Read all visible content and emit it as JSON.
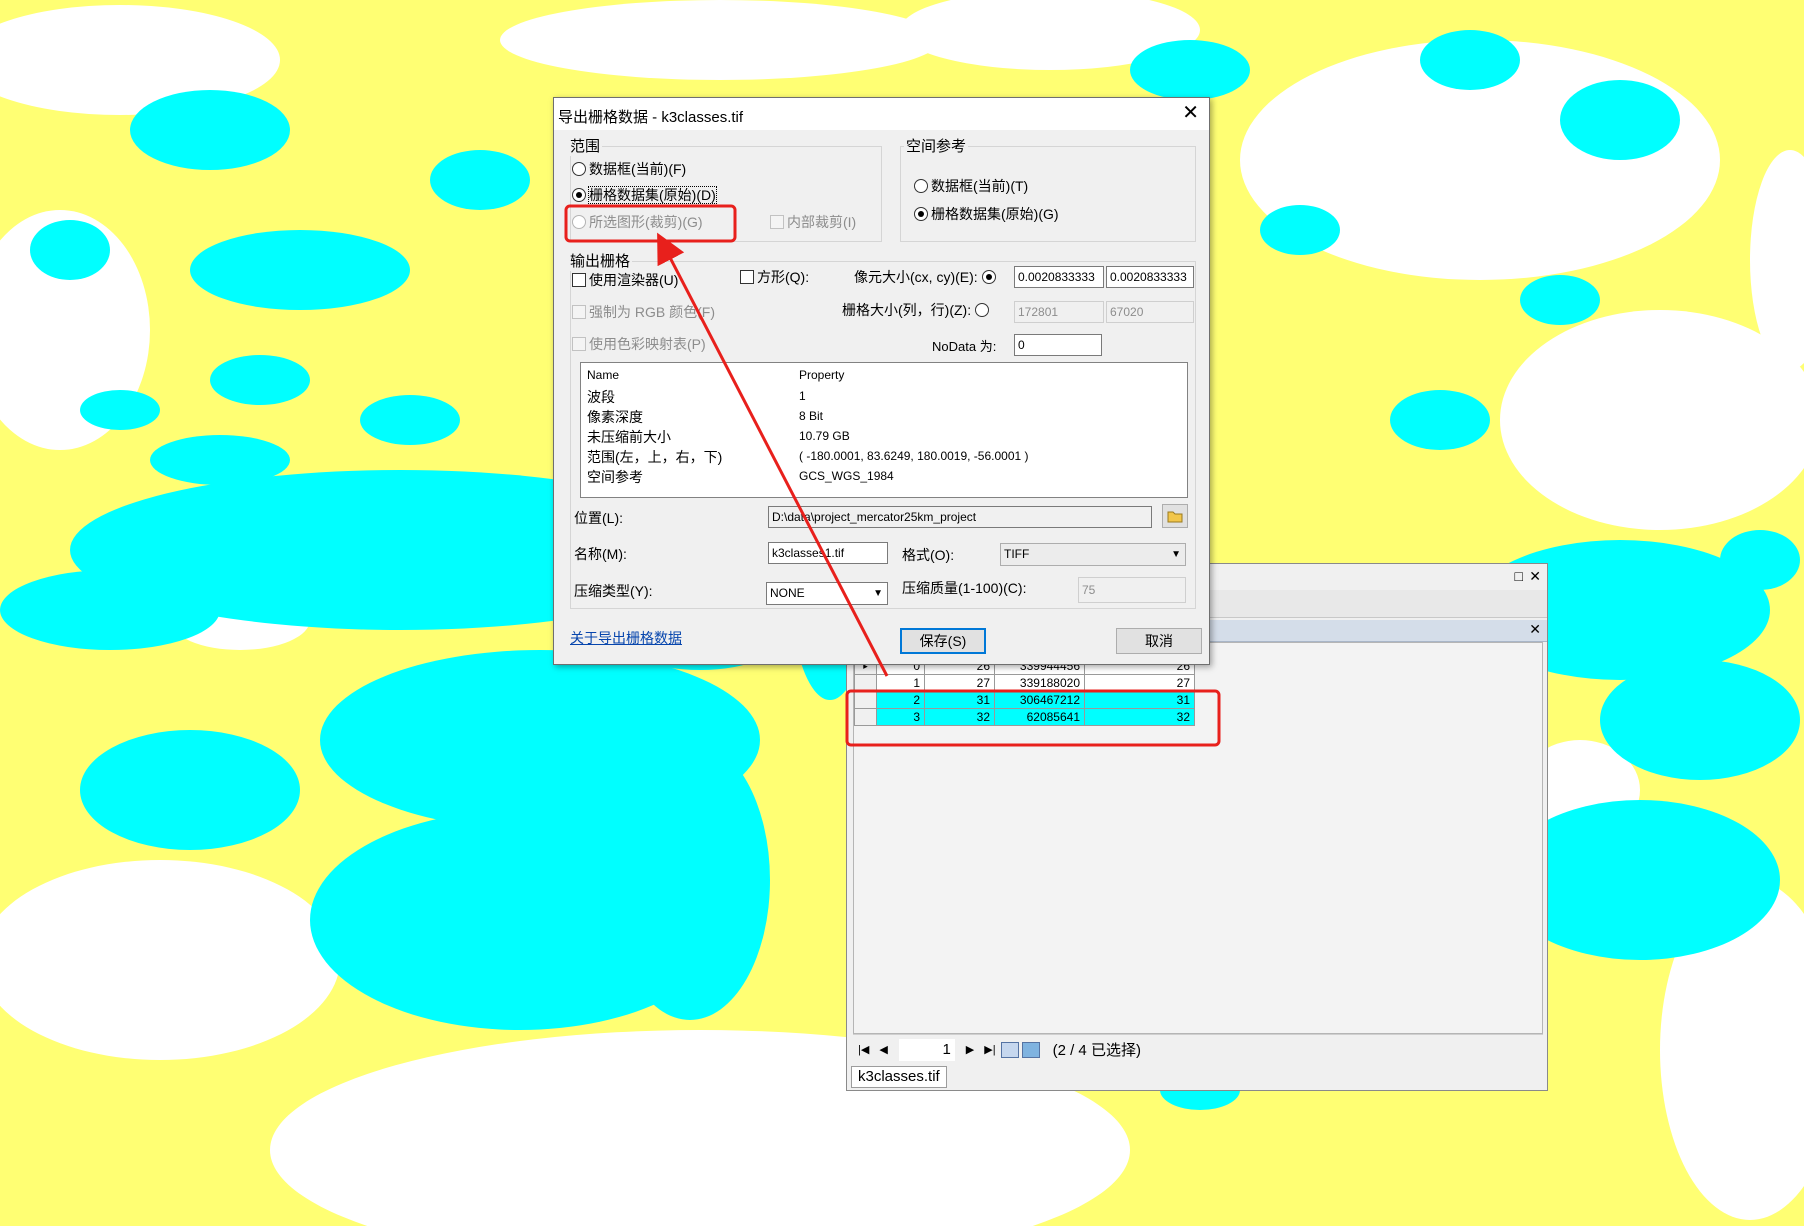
{
  "colors": {
    "map_yellow": "#ffff73",
    "map_cyan": "#00ffff",
    "highlight_red": "#e8201c",
    "row_selected": "#00ffff"
  },
  "attribute_table": {
    "rows": [
      {
        "rowid": "0",
        "value": "26",
        "count": "339944456",
        "class": "26"
      },
      {
        "rowid": "1",
        "value": "27",
        "count": "339188020",
        "class": "27"
      },
      {
        "rowid": "2",
        "value": "31",
        "count": "306467212",
        "class": "31"
      },
      {
        "rowid": "3",
        "value": "32",
        "count": "62085641",
        "class": "32"
      }
    ],
    "page": "1",
    "status": "(2 / 4 已选择)",
    "tab_name": "k3classes.tif"
  },
  "dialog": {
    "title": "导出栅格数据 - k3classes.tif",
    "extent": {
      "legend": "范围",
      "opt_data_frame": "数据框(当前)(F)",
      "opt_raster_dataset": "栅格数据集(原始)(D)",
      "opt_selected_graphics": "所选图形(裁剪)(G)",
      "opt_inside_clip": "内部裁剪(I)",
      "selected": "raster_dataset"
    },
    "spatial_ref": {
      "legend": "空间参考",
      "opt_data_frame": "数据框(当前)(T)",
      "opt_raster_dataset": "栅格数据集(原始)(G)"
    },
    "output": {
      "legend": "输出栅格",
      "use_renderer": "使用渲染器(U)",
      "square": "方形(Q):",
      "force_rgb": "强制为 RGB 颜色(F)",
      "use_colormap": "使用色彩映射表(P)",
      "cell_size_label": "像元大小(cx, cy)(E):",
      "cell_cx": "0.0020833333",
      "cell_cy": "0.0020833333",
      "raster_size_label": "栅格大小(列，行)(Z):",
      "cols": "172801",
      "rows": "67020",
      "nodata_label": "NoData 为:",
      "nodata": "0"
    },
    "properties": {
      "header_name": "Name",
      "header_property": "Property",
      "items": [
        {
          "name": "波段",
          "value": "1"
        },
        {
          "name": "像素深度",
          "value": "8 Bit"
        },
        {
          "name": "未压缩前大小",
          "value": "10.79 GB"
        },
        {
          "name": "范围(左，上，右，下)",
          "value": "( -180.0001, 83.6249, 180.0019, -56.0001 )"
        },
        {
          "name": "空间参考",
          "value": "GCS_WGS_1984"
        }
      ]
    },
    "location_label": "位置(L):",
    "location": "D:\\data\\project_mercator25km_project",
    "name_label": "名称(M):",
    "name": "k3classes1.tif",
    "format_label": "格式(O):",
    "format": "TIFF",
    "compression_label": "压缩类型(Y):",
    "compression": "NONE",
    "quality_label": "压缩质量(1-100)(C):",
    "quality": "75",
    "help_link": "关于导出栅格数据",
    "save": "保存(S)",
    "cancel": "取消"
  }
}
